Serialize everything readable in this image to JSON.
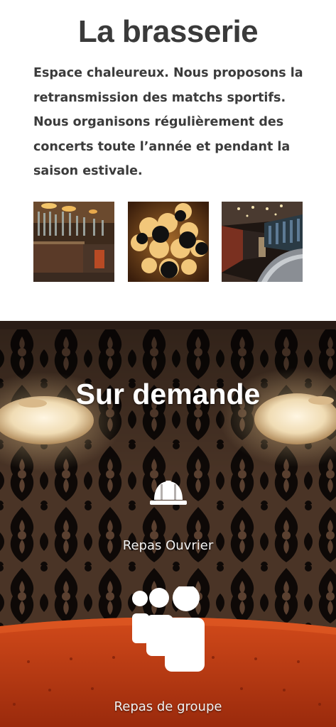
{
  "intro": {
    "title": "La brasserie",
    "description": "Espace chaleureux. Nous proposons la retransmission des matchs sportifs. Nous organisons régulièrement des concerts toute l’année et pendant la saison estivale."
  },
  "gallery": {
    "images": [
      {
        "icon": "brasserie-bar-photo"
      },
      {
        "icon": "spherical-lamp-photo"
      },
      {
        "icon": "brasserie-dining-room-photo"
      }
    ]
  },
  "on_demand": {
    "heading": "Sur demande",
    "services": [
      {
        "label": "Repas Ouvrier",
        "icon": "hard-hat-icon"
      },
      {
        "label": "Repas de groupe",
        "icon": "group-people-icon"
      }
    ]
  },
  "colors": {
    "text_dark": "#3b3b3b",
    "banner_wall": "#1a120d",
    "banquette_red": "#c93a12",
    "white": "#ffffff"
  }
}
